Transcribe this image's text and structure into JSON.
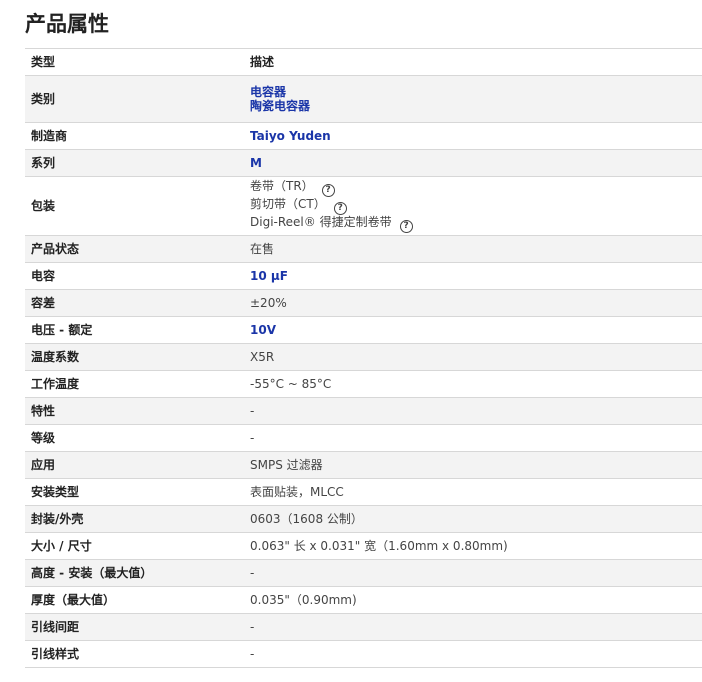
{
  "page_title": "产品属性",
  "header": {
    "col1": "类型",
    "col2": "描述"
  },
  "rows": {
    "category": {
      "label": "类别",
      "values": [
        "电容器",
        "陶瓷电容器"
      ]
    },
    "manufacturer": {
      "label": "制造商",
      "value": "Taiyo Yuden"
    },
    "series": {
      "label": "系列",
      "value": "M"
    },
    "packaging": {
      "label": "包装",
      "options": [
        "卷带（TR）",
        "剪切带（CT）",
        "Digi-Reel® 得捷定制卷带"
      ]
    },
    "status": {
      "label": "产品状态",
      "value": "在售"
    },
    "capacitance": {
      "label": "电容",
      "value": "10 µF"
    },
    "tolerance": {
      "label": "容差",
      "value": "±20%"
    },
    "voltage": {
      "label": "电压 - 额定",
      "value": "10V"
    },
    "temp_coef": {
      "label": "温度系数",
      "value": "X5R"
    },
    "op_temp": {
      "label": "工作温度",
      "value": "-55°C ~ 85°C"
    },
    "features": {
      "label": "特性",
      "value": "-"
    },
    "rating": {
      "label": "等级",
      "value": "-"
    },
    "application": {
      "label": "应用",
      "value": "SMPS 过滤器"
    },
    "mount_type": {
      "label": "安装类型",
      "value": "表面贴装，MLCC"
    },
    "package": {
      "label": "封装/外壳",
      "value": "0603（1608 公制）"
    },
    "size": {
      "label": "大小 / 尺寸",
      "value": "0.063\" 长 x 0.031\" 宽（1.60mm x 0.80mm)"
    },
    "height": {
      "label": "高度 - 安装（最大值）",
      "value": "-"
    },
    "thickness": {
      "label": "厚度（最大值）",
      "value": "0.035\"（0.90mm)"
    },
    "lead_spacing": {
      "label": "引线间距",
      "value": "-"
    },
    "lead_style": {
      "label": "引线样式",
      "value": "-"
    }
  },
  "icons": {
    "help": "help-circle-icon"
  },
  "colors": {
    "link": "#1a35a8",
    "stripe": "#f3f3f3",
    "border": "#d7d7d7"
  }
}
